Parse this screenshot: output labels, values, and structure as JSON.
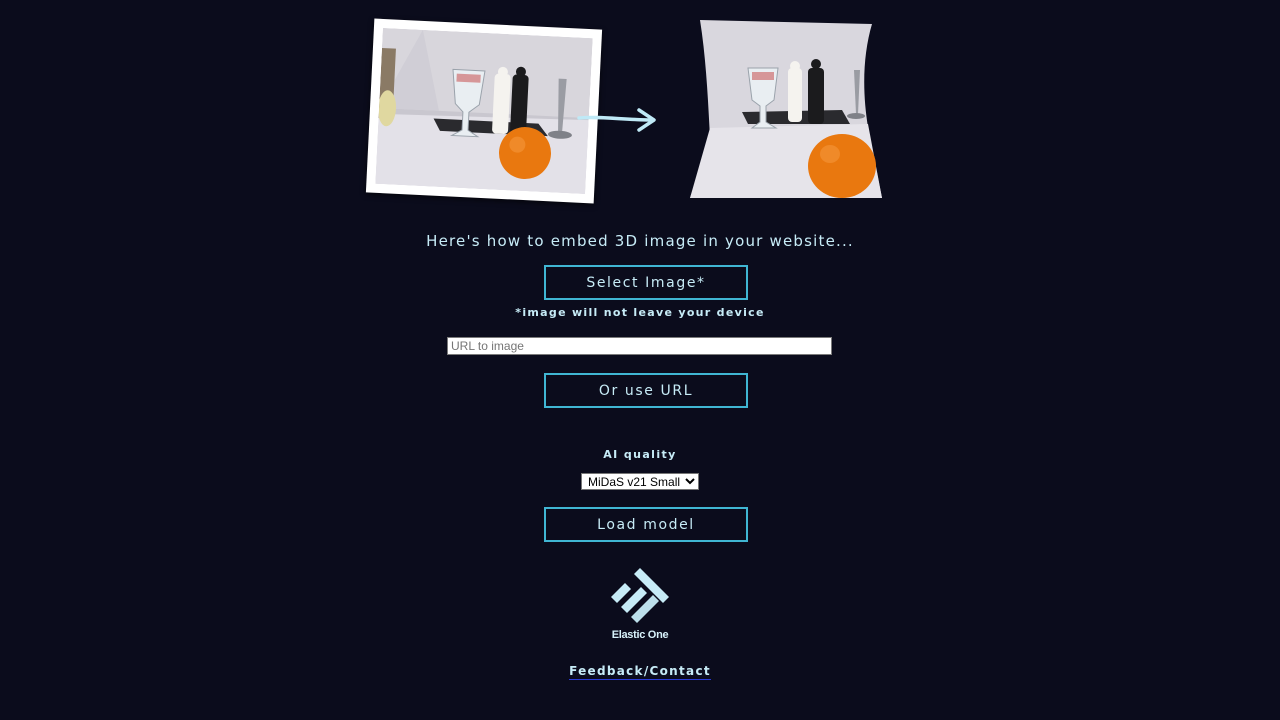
{
  "hero": {
    "before_image": "photo-of-glass-pepper-mills-and-orange",
    "after_image": "3d-warped-depth-version-of-photo",
    "arrow_icon": "arrow-right-icon"
  },
  "tagline": "Here's how to embed 3D image in your website...",
  "select_image_button": "Select Image*",
  "privacy_note": "*image will not leave your device",
  "url_input": {
    "placeholder": "URL to image",
    "value": ""
  },
  "use_url_button": "Or use URL",
  "ai_quality": {
    "label": "AI quality",
    "selected": "MiDaS v21 Small",
    "options": [
      "MiDaS v21 Small"
    ]
  },
  "load_model_button": "Load model",
  "brand": {
    "name": "Elastic One",
    "logo_icon": "elastic-one-logo-icon"
  },
  "footer": {
    "feedback_link": "Feedback/Contact"
  },
  "colors": {
    "background": "#0b0c1c",
    "accent_border": "#40b6d3",
    "text": "#c7ecf7"
  }
}
